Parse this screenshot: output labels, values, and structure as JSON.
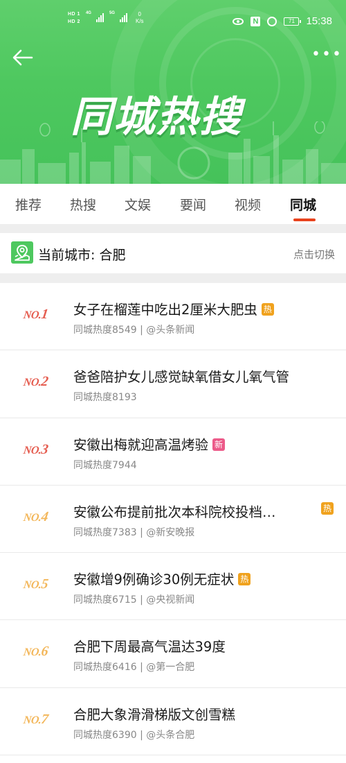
{
  "status_bar": {
    "hd1": "HD 1",
    "hd2": "HD 2",
    "sig1_label": "4G",
    "sig2_label": "5G",
    "speed_value": "0",
    "speed_unit": "K/s",
    "battery": "71",
    "time": "15:38"
  },
  "header": {
    "back_icon": "arrow-left-icon",
    "more_icon": "more-dots-icon",
    "more_label": "•••",
    "banner_title": "同城热搜",
    "background_color": "#4ec85f"
  },
  "tabs": {
    "items": [
      {
        "label": "推荐"
      },
      {
        "label": "热搜"
      },
      {
        "label": "文娱"
      },
      {
        "label": "要闻"
      },
      {
        "label": "视频"
      },
      {
        "label": "同城"
      }
    ],
    "active_index": 5,
    "active_color": "#e8421d"
  },
  "city": {
    "icon": "location-map-icon",
    "label": "当前城市: 合肥",
    "switch_label": "点击切换"
  },
  "list": {
    "items": [
      {
        "rank": "1",
        "title": "女子在榴莲中吃出2厘米大肥虫",
        "badge": "热",
        "meta": "同城热度8549 | @头条新闻"
      },
      {
        "rank": "2",
        "title": "爸爸陪护女儿感觉缺氧借女儿氧气管",
        "badge": "",
        "meta": "同城热度8193"
      },
      {
        "rank": "3",
        "title": "安徽出梅就迎高温烤验",
        "badge": "新",
        "meta": "同城热度7944"
      },
      {
        "rank": "4",
        "title": "安徽公布提前批次本科院校投档…",
        "badge": "热",
        "meta": "同城热度7383 | @新安晚报"
      },
      {
        "rank": "5",
        "title": "安徽增9例确诊30例无症状",
        "badge": "热",
        "meta": "同城热度6715 | @央视新闻"
      },
      {
        "rank": "6",
        "title": "合肥下周最高气温达39度",
        "badge": "",
        "meta": "同城热度6416 | @第一合肥"
      },
      {
        "rank": "7",
        "title": "合肥大象滑滑梯版文创雪糕",
        "badge": "",
        "meta": "同城热度6390 | @头条合肥"
      }
    ],
    "rank_prefix": "NO.",
    "colors": {
      "top3": "#e55d50",
      "rest": "#f3b75b",
      "hot_badge": "#f0a21e",
      "new_badge": "#ec5a89"
    }
  }
}
